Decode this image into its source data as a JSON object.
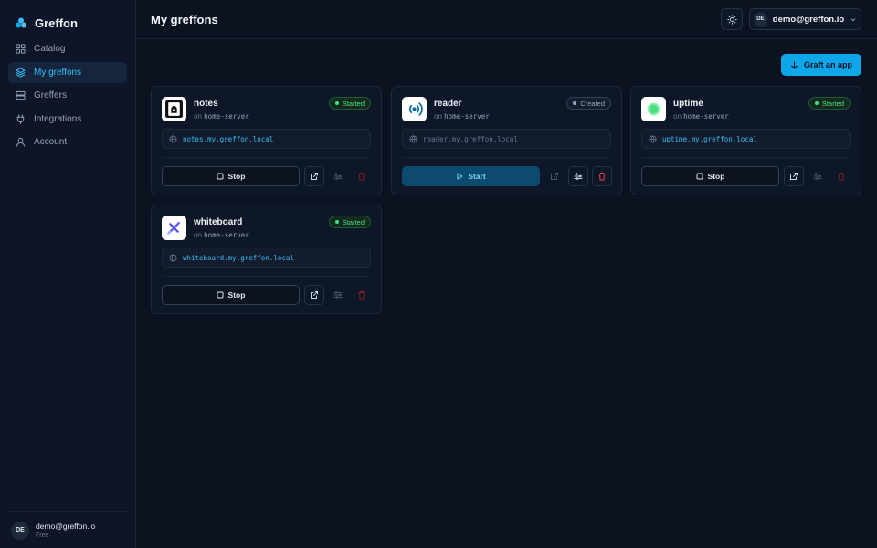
{
  "brand": {
    "name": "Greffon"
  },
  "sidebar": {
    "items": [
      {
        "label": "Catalog",
        "icon": "grid-icon",
        "active": false
      },
      {
        "label": "My greffons",
        "icon": "layers-icon",
        "active": true
      },
      {
        "label": "Greffers",
        "icon": "server-icon",
        "active": false
      },
      {
        "label": "Integrations",
        "icon": "plug-icon",
        "active": false
      },
      {
        "label": "Account",
        "icon": "user-icon",
        "active": false
      }
    ],
    "footer": {
      "initials": "DE",
      "email": "demo@greffon.io",
      "plan": "Free"
    }
  },
  "header": {
    "title": "My greffons",
    "user": {
      "initials": "DE",
      "email": "demo@greffon.io"
    }
  },
  "graft_button": {
    "label": "Graft an app"
  },
  "host_prefix": "on",
  "cards": [
    {
      "name": "notes",
      "host": "home-server",
      "status": "Started",
      "url": "notes.my.greffon.local",
      "action": "Stop"
    },
    {
      "name": "reader",
      "host": "home-server",
      "status": "Created",
      "url": "reader.my.greffon.local",
      "action": "Start"
    },
    {
      "name": "uptime",
      "host": "home-server",
      "status": "Started",
      "url": "uptime.my.greffon.local",
      "action": "Stop"
    },
    {
      "name": "whiteboard",
      "host": "home-server",
      "status": "Started",
      "url": "whiteboard.my.greffon.local",
      "action": "Stop"
    }
  ],
  "colors": {
    "accent": "#0ea5e9",
    "started": "#4ade80",
    "danger": "#ef4444",
    "background": "#0b1220"
  }
}
